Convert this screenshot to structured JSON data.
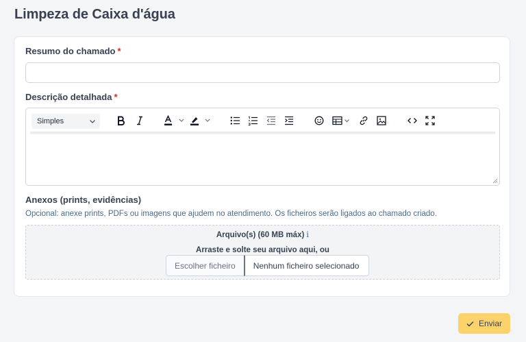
{
  "page": {
    "title": "Limpeza de Caixa d'água"
  },
  "form": {
    "summary": {
      "label": "Resumo do chamado",
      "required_mark": "*",
      "value": "",
      "placeholder": ""
    },
    "description": {
      "label": "Descrição detalhada",
      "required_mark": "*",
      "toolbar": {
        "format_value": "Simples",
        "buttons": [
          "bold-icon",
          "italic-icon",
          "font-color-icon",
          "highlight-icon",
          "bullet-list-icon",
          "numbered-list-icon",
          "outdent-icon",
          "indent-icon",
          "emoji-icon",
          "table-icon",
          "link-icon",
          "image-icon",
          "code-icon",
          "fullscreen-icon"
        ]
      },
      "value": ""
    },
    "attachments": {
      "label": "Anexos (prints, evidências)",
      "help": "Opcional: anexe prints, PDFs ou imagens que ajudem no atendimento. Os ficheiros serão ligados ao chamado criado.",
      "dropzone_title": "Arquivo(s) (60 MB máx)",
      "info_glyph": "i",
      "dropzone_hint": "Arraste e solte seu arquivo aqui, ou",
      "choose_label": "Escolher ficheiro",
      "no_file_label": "Nenhum ficheiro selecionado"
    }
  },
  "actions": {
    "submit_label": "Enviar"
  },
  "colors": {
    "accent": "#fcd26b",
    "required": "#dc2626",
    "help_text": "#4b6a8a",
    "info": "#3b6fb6"
  }
}
